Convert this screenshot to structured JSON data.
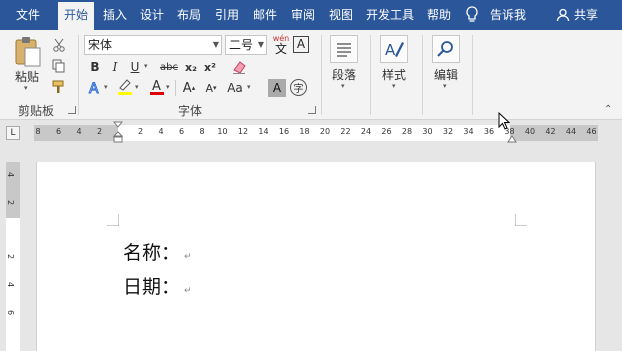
{
  "menubar": {
    "tabs": [
      "文件",
      "开始",
      "插入",
      "设计",
      "布局",
      "引用",
      "邮件",
      "审阅",
      "视图",
      "开发工具",
      "帮助"
    ],
    "active_tab": "开始",
    "tell_me": "告诉我",
    "share": "共享"
  },
  "ribbon": {
    "clipboard": {
      "paste_label": "粘贴",
      "group_label": "剪贴板"
    },
    "font": {
      "font_name": "宋体",
      "font_size": "二号",
      "wen_label": "wén",
      "wen_char": "文",
      "boxed_a": "A",
      "bold": "B",
      "italic": "I",
      "underline": "U",
      "strike": "abc",
      "subscript": "x₂",
      "superscript": "x²",
      "grow": "A",
      "shrink": "A",
      "aa": "Aa",
      "char_shading": "A",
      "phonetic": "字",
      "group_label": "字体"
    },
    "paragraph": {
      "label": "段落"
    },
    "styles": {
      "label": "样式"
    },
    "editing": {
      "label": "编辑"
    }
  },
  "ruler": {
    "corner": "L",
    "ticks": [
      "8",
      "6",
      "4",
      "2",
      "2",
      "4",
      "6",
      "8",
      "10",
      "12",
      "14",
      "16",
      "18",
      "20",
      "22",
      "24",
      "26",
      "28",
      "30",
      "32",
      "34",
      "36",
      "38",
      "40",
      "42",
      "44",
      "46"
    ]
  },
  "vruler": {
    "ticks": [
      "4",
      "2",
      "2",
      "4",
      "6"
    ]
  },
  "document": {
    "lines": [
      "名称：",
      "日期："
    ],
    "paragraph_mark": "↵"
  },
  "colors": {
    "menubar": "#2b579a",
    "highlight": "#ffff00",
    "font_color": "#e00000"
  }
}
